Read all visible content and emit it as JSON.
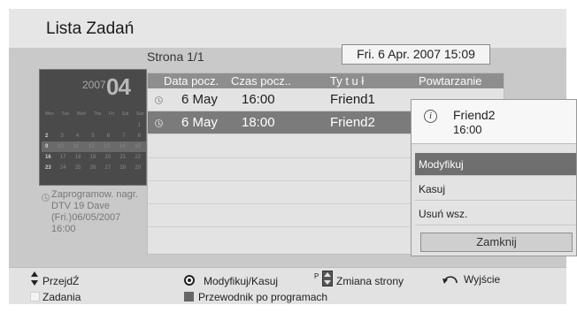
{
  "window": {
    "title": "Lista Zadań"
  },
  "page_info": "Strona 1/1",
  "current_datetime": "Fri. 6 Apr. 2007 15:09",
  "calendar": {
    "year": "2007",
    "month": "04",
    "weekdays": [
      "Mon",
      "Tue",
      "Wed",
      "Thu",
      "Fri",
      "Sat",
      "Sun"
    ],
    "weeks": [
      [
        "",
        "",
        "",
        "",
        "",
        "",
        "1"
      ],
      [
        "2",
        "3",
        "4",
        "5",
        "6",
        "7",
        "8"
      ],
      [
        "9",
        "10",
        "11",
        "12",
        "13",
        "14",
        "15"
      ],
      [
        "16",
        "17",
        "18",
        "19",
        "20",
        "21",
        "22"
      ],
      [
        "23",
        "24",
        "25",
        "26",
        "27",
        "28",
        "29"
      ]
    ]
  },
  "scheduled_info": {
    "line1": "Zaprogramow. nagr.",
    "line2": "DTV 19 Dave",
    "line3": "(Fri.)06/05/2007",
    "line4": "16:00"
  },
  "table": {
    "columns": [
      "Data pocz.",
      "Czas pocz..",
      "Ty t u ł",
      "Powtarzanie"
    ],
    "rows": [
      {
        "date": "6 May",
        "time": "16:00",
        "title": "Friend1",
        "selected": false
      },
      {
        "date": "6 May",
        "time": "18:00",
        "title": "Friend2",
        "selected": true
      }
    ]
  },
  "popup": {
    "info_symbol": "i",
    "program_name": "Friend2",
    "program_time": "16:00",
    "items": [
      "Modyfikuj",
      "Kasuj",
      "Usuń wsz."
    ],
    "close_label": "Zamknij"
  },
  "footer": {
    "navigate": "PrzejdŹ",
    "modify_delete": "Modyfikuj/Kasuj",
    "page_key": "P",
    "page_change": "Zmiana strony",
    "exit": "Wyjście",
    "tasks": "Zadania",
    "guide": "Przewodnik po programach"
  },
  "colors": {
    "selected_row": "#7b7b7b",
    "header_row": "#8e8e8e",
    "panel_bg": "#c9c9c9",
    "tasks_key": "#f2f2f2",
    "guide_key": "#666666"
  },
  "icons": {
    "row": "record-clock-icon",
    "popup": "info-icon",
    "navigate": "up-down-arrows-icon",
    "ok": "ok-button-icon",
    "page": "page-up-down-icon",
    "exit": "back-return-icon"
  }
}
